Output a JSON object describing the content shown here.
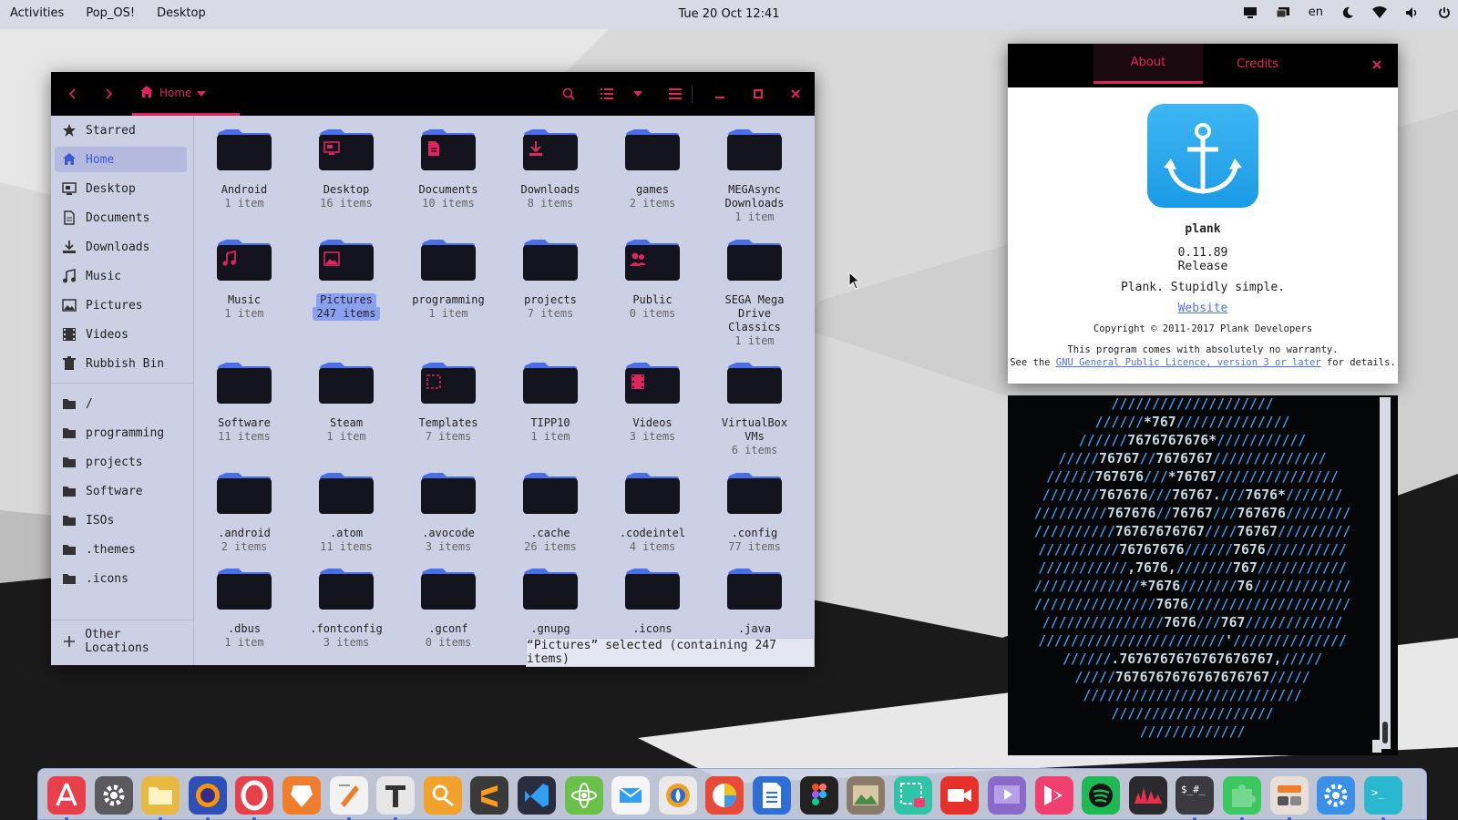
{
  "topbar": {
    "activities": "Activities",
    "app_menu": "Pop_OS!",
    "desktop_menu": "Desktop",
    "clock": "Tue 20 Oct 12:41",
    "keyboard_layout": "en",
    "icons": [
      "screen-icon",
      "display-icon",
      "night-light-icon",
      "wifi-icon",
      "volume-icon",
      "power-icon"
    ]
  },
  "file_manager": {
    "location_label": "Home",
    "header_icons": [
      "back-arrow-icon",
      "forward-arrow-icon",
      "home-icon",
      "search-icon",
      "list-view-icon",
      "view-options-chevron-icon",
      "menu-icon",
      "minimize-icon",
      "maximize-icon",
      "close-icon"
    ],
    "sidebar": {
      "places": [
        {
          "label": "Starred",
          "icon": "star-icon"
        },
        {
          "label": "Home",
          "icon": "home-icon",
          "active": true
        },
        {
          "label": "Desktop",
          "icon": "desktop-icon"
        },
        {
          "label": "Documents",
          "icon": "document-icon"
        },
        {
          "label": "Downloads",
          "icon": "download-icon"
        },
        {
          "label": "Music",
          "icon": "music-icon"
        },
        {
          "label": "Pictures",
          "icon": "picture-icon"
        },
        {
          "label": "Videos",
          "icon": "video-icon"
        },
        {
          "label": "Rubbish Bin",
          "icon": "trash-icon"
        }
      ],
      "bookmarks": [
        {
          "label": "/",
          "icon": "folder-icon"
        },
        {
          "label": "programming",
          "icon": "folder-icon"
        },
        {
          "label": "projects",
          "icon": "folder-icon"
        },
        {
          "label": "Software",
          "icon": "folder-icon"
        },
        {
          "label": "ISOs",
          "icon": "folder-icon"
        },
        {
          "label": ".themes",
          "icon": "folder-icon"
        },
        {
          "label": ".icons",
          "icon": "folder-icon"
        }
      ],
      "other_locations": "Other Locations"
    },
    "items": [
      {
        "name": "Android",
        "count": "1 item",
        "emblem": ""
      },
      {
        "name": "Desktop",
        "count": "16 items",
        "emblem": "desktop"
      },
      {
        "name": "Documents",
        "count": "10 items",
        "emblem": "document"
      },
      {
        "name": "Downloads",
        "count": "8 items",
        "emblem": "download"
      },
      {
        "name": "games",
        "count": "2 items",
        "emblem": ""
      },
      {
        "name": "MEGAsync Downloads",
        "count": "1 item",
        "emblem": ""
      },
      {
        "name": "Music",
        "count": "1 item",
        "emblem": "music"
      },
      {
        "name": "Pictures",
        "count": "247 items",
        "emblem": "picture",
        "selected": true
      },
      {
        "name": "programming",
        "count": "1 item",
        "emblem": ""
      },
      {
        "name": "projects",
        "count": "7 items",
        "emblem": ""
      },
      {
        "name": "Public",
        "count": "0 items",
        "emblem": "public"
      },
      {
        "name": "SEGA Mega Drive Classics",
        "count": "1 item",
        "emblem": ""
      },
      {
        "name": "Software",
        "count": "11 items",
        "emblem": ""
      },
      {
        "name": "Steam",
        "count": "1 item",
        "emblem": ""
      },
      {
        "name": "Templates",
        "count": "7 items",
        "emblem": "template"
      },
      {
        "name": "TIPP10",
        "count": "1 item",
        "emblem": ""
      },
      {
        "name": "Videos",
        "count": "3 items",
        "emblem": "video"
      },
      {
        "name": "VirtualBox VMs",
        "count": "6 items",
        "emblem": ""
      },
      {
        "name": ".android",
        "count": "2 items",
        "emblem": ""
      },
      {
        "name": ".atom",
        "count": "11 items",
        "emblem": ""
      },
      {
        "name": ".avocode",
        "count": "3 items",
        "emblem": ""
      },
      {
        "name": ".cache",
        "count": "26 items",
        "emblem": ""
      },
      {
        "name": ".codeintel",
        "count": "4 items",
        "emblem": ""
      },
      {
        "name": ".config",
        "count": "77 items",
        "emblem": ""
      },
      {
        "name": ".dbus",
        "count": "1 item",
        "emblem": ""
      },
      {
        "name": ".fontconfig",
        "count": "3 items",
        "emblem": ""
      },
      {
        "name": ".gconf",
        "count": "0 items",
        "emblem": ""
      },
      {
        "name": ".gnupg",
        "count": "",
        "emblem": ""
      },
      {
        "name": ".icons",
        "count": "",
        "emblem": ""
      },
      {
        "name": ".java",
        "count": "",
        "emblem": ""
      }
    ],
    "status": "“Pictures” selected (containing 247 items)"
  },
  "about_dialog": {
    "tabs": [
      "About",
      "Credits"
    ],
    "active_tab": "About",
    "app_name": "plank",
    "version": "0.11.89",
    "release": "Release",
    "tagline": "Plank. Stupidly simple.",
    "website_link": "Website",
    "copyright": "Copyright © 2011-2017 Plank Developers",
    "warranty_line1": "This program comes with absolutely no warranty.",
    "warranty_prefix": "See the ",
    "license_link": "GNU General Public Licence, version 3 or later",
    "warranty_suffix": " for details."
  },
  "terminal": {
    "ascii_art": [
      "////////////////////",
      "//////*767//////////////",
      "//////7676767676*///////////",
      "/////76767//7676767//////////////",
      "//////767676///*76767///////////////",
      "///////767676///76767.///7676*///////",
      "/////////767676//76767///767676////////",
      "//////////76767676767////76767/////////",
      "//////////76767676//////7676//////////",
      "///////////,7676,///////767///////////",
      "/////////////*7676///////76////////////",
      "///////////////7676////////////////////",
      "///////////////7676///767////////////",
      "///////////////////////'//////////////",
      "//////.7676767676767676767,/////",
      "/////7676767676767676767/////",
      "///////////////////////////",
      "////////////////////",
      "/////////////"
    ]
  },
  "dock": {
    "apps": [
      {
        "name": "app-center-icon",
        "bg": "#e8404a",
        "running": true
      },
      {
        "name": "settings-gear-icon",
        "bg": "#5a5a5e",
        "running": false
      },
      {
        "name": "files-folder-icon",
        "bg": "#e9b840",
        "running": true
      },
      {
        "name": "firefox-icon",
        "bg": "#2f4fb8",
        "running": true
      },
      {
        "name": "opera-icon",
        "bg": "#e8404a",
        "running": true
      },
      {
        "name": "brave-icon",
        "bg": "#f07d2c",
        "running": false
      },
      {
        "name": "text-editor-icon",
        "bg": "#f2f2f2",
        "running": true
      },
      {
        "name": "typora-icon",
        "bg": "#e6e6e6",
        "running": true
      },
      {
        "name": "avocode-icon",
        "bg": "#f2a12a",
        "running": false
      },
      {
        "name": "sublime-text-icon",
        "bg": "#3a3a3a",
        "running": false
      },
      {
        "name": "vscode-icon",
        "bg": "#2a2d3e",
        "running": false
      },
      {
        "name": "atom-icon",
        "bg": "#6bc04a",
        "running": false
      },
      {
        "name": "mailspring-icon",
        "bg": "#f5f5f5",
        "running": false
      },
      {
        "name": "color-picker-icon",
        "bg": "#eaeaea",
        "running": false
      },
      {
        "name": "quick-look-icon",
        "bg": "#e84a3a",
        "running": false
      },
      {
        "name": "libreoffice-writer-icon",
        "bg": "#2d6fd6",
        "running": false
      },
      {
        "name": "figma-icon",
        "bg": "#222222",
        "running": false
      },
      {
        "name": "image-viewer-icon",
        "bg": "#8a7a6a",
        "running": false
      },
      {
        "name": "screenshot-icon",
        "bg": "#2ec4a8",
        "running": false
      },
      {
        "name": "screen-recorder-icon",
        "bg": "#e8302a",
        "running": false
      },
      {
        "name": "video-player-icon",
        "bg": "#8a6ac8",
        "running": false
      },
      {
        "name": "kdenlive-icon",
        "bg": "#f04070",
        "running": false
      },
      {
        "name": "spotify-icon",
        "bg": "#1db954",
        "running": false
      },
      {
        "name": "audio-waveform-icon",
        "bg": "#2a2a2e",
        "running": false
      },
      {
        "name": "terminal-prompt-icon",
        "bg": "#3a3a40",
        "running": true
      },
      {
        "name": "puzzle-extension-icon",
        "bg": "#3cc860",
        "running": true
      },
      {
        "name": "tweaks-icon",
        "bg": "#e8e0d8",
        "running": true
      },
      {
        "name": "system-gear-icon",
        "bg": "#3a90e8",
        "running": false
      },
      {
        "name": "terminal-icon",
        "bg": "#2ab8d0",
        "running": true
      }
    ]
  },
  "colors": {
    "accent": "#e0245e",
    "selection": "#8ca0f0",
    "sidebar_active": "#3d5bd9",
    "folder_body": "#12131c",
    "folder_tab": "#4a6ee8"
  }
}
